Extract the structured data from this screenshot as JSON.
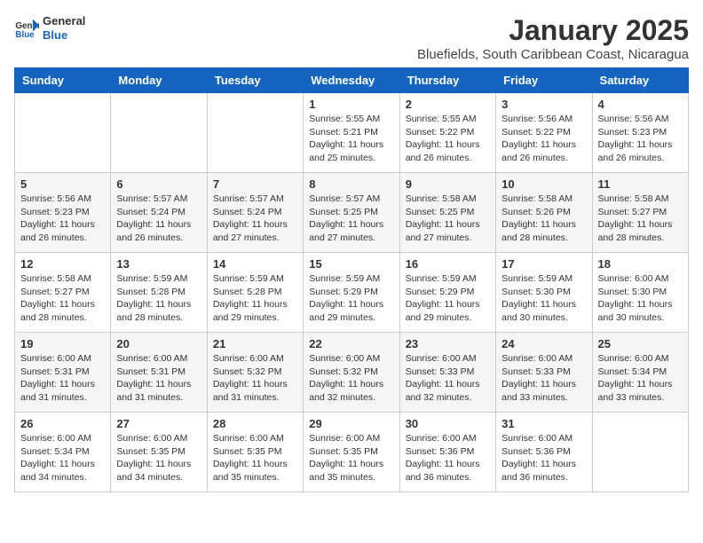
{
  "logo": {
    "general": "General",
    "blue": "Blue"
  },
  "title": "January 2025",
  "subtitle": "Bluefields, South Caribbean Coast, Nicaragua",
  "days_of_week": [
    "Sunday",
    "Monday",
    "Tuesday",
    "Wednesday",
    "Thursday",
    "Friday",
    "Saturday"
  ],
  "weeks": [
    [
      {
        "day": "",
        "info": ""
      },
      {
        "day": "",
        "info": ""
      },
      {
        "day": "",
        "info": ""
      },
      {
        "day": "1",
        "info": "Sunrise: 5:55 AM\nSunset: 5:21 PM\nDaylight: 11 hours and 25 minutes."
      },
      {
        "day": "2",
        "info": "Sunrise: 5:55 AM\nSunset: 5:22 PM\nDaylight: 11 hours and 26 minutes."
      },
      {
        "day": "3",
        "info": "Sunrise: 5:56 AM\nSunset: 5:22 PM\nDaylight: 11 hours and 26 minutes."
      },
      {
        "day": "4",
        "info": "Sunrise: 5:56 AM\nSunset: 5:23 PM\nDaylight: 11 hours and 26 minutes."
      }
    ],
    [
      {
        "day": "5",
        "info": "Sunrise: 5:56 AM\nSunset: 5:23 PM\nDaylight: 11 hours and 26 minutes."
      },
      {
        "day": "6",
        "info": "Sunrise: 5:57 AM\nSunset: 5:24 PM\nDaylight: 11 hours and 26 minutes."
      },
      {
        "day": "7",
        "info": "Sunrise: 5:57 AM\nSunset: 5:24 PM\nDaylight: 11 hours and 27 minutes."
      },
      {
        "day": "8",
        "info": "Sunrise: 5:57 AM\nSunset: 5:25 PM\nDaylight: 11 hours and 27 minutes."
      },
      {
        "day": "9",
        "info": "Sunrise: 5:58 AM\nSunset: 5:25 PM\nDaylight: 11 hours and 27 minutes."
      },
      {
        "day": "10",
        "info": "Sunrise: 5:58 AM\nSunset: 5:26 PM\nDaylight: 11 hours and 28 minutes."
      },
      {
        "day": "11",
        "info": "Sunrise: 5:58 AM\nSunset: 5:27 PM\nDaylight: 11 hours and 28 minutes."
      }
    ],
    [
      {
        "day": "12",
        "info": "Sunrise: 5:58 AM\nSunset: 5:27 PM\nDaylight: 11 hours and 28 minutes."
      },
      {
        "day": "13",
        "info": "Sunrise: 5:59 AM\nSunset: 5:28 PM\nDaylight: 11 hours and 28 minutes."
      },
      {
        "day": "14",
        "info": "Sunrise: 5:59 AM\nSunset: 5:28 PM\nDaylight: 11 hours and 29 minutes."
      },
      {
        "day": "15",
        "info": "Sunrise: 5:59 AM\nSunset: 5:29 PM\nDaylight: 11 hours and 29 minutes."
      },
      {
        "day": "16",
        "info": "Sunrise: 5:59 AM\nSunset: 5:29 PM\nDaylight: 11 hours and 29 minutes."
      },
      {
        "day": "17",
        "info": "Sunrise: 5:59 AM\nSunset: 5:30 PM\nDaylight: 11 hours and 30 minutes."
      },
      {
        "day": "18",
        "info": "Sunrise: 6:00 AM\nSunset: 5:30 PM\nDaylight: 11 hours and 30 minutes."
      }
    ],
    [
      {
        "day": "19",
        "info": "Sunrise: 6:00 AM\nSunset: 5:31 PM\nDaylight: 11 hours and 31 minutes."
      },
      {
        "day": "20",
        "info": "Sunrise: 6:00 AM\nSunset: 5:31 PM\nDaylight: 11 hours and 31 minutes."
      },
      {
        "day": "21",
        "info": "Sunrise: 6:00 AM\nSunset: 5:32 PM\nDaylight: 11 hours and 31 minutes."
      },
      {
        "day": "22",
        "info": "Sunrise: 6:00 AM\nSunset: 5:32 PM\nDaylight: 11 hours and 32 minutes."
      },
      {
        "day": "23",
        "info": "Sunrise: 6:00 AM\nSunset: 5:33 PM\nDaylight: 11 hours and 32 minutes."
      },
      {
        "day": "24",
        "info": "Sunrise: 6:00 AM\nSunset: 5:33 PM\nDaylight: 11 hours and 33 minutes."
      },
      {
        "day": "25",
        "info": "Sunrise: 6:00 AM\nSunset: 5:34 PM\nDaylight: 11 hours and 33 minutes."
      }
    ],
    [
      {
        "day": "26",
        "info": "Sunrise: 6:00 AM\nSunset: 5:34 PM\nDaylight: 11 hours and 34 minutes."
      },
      {
        "day": "27",
        "info": "Sunrise: 6:00 AM\nSunset: 5:35 PM\nDaylight: 11 hours and 34 minutes."
      },
      {
        "day": "28",
        "info": "Sunrise: 6:00 AM\nSunset: 5:35 PM\nDaylight: 11 hours and 35 minutes."
      },
      {
        "day": "29",
        "info": "Sunrise: 6:00 AM\nSunset: 5:35 PM\nDaylight: 11 hours and 35 minutes."
      },
      {
        "day": "30",
        "info": "Sunrise: 6:00 AM\nSunset: 5:36 PM\nDaylight: 11 hours and 36 minutes."
      },
      {
        "day": "31",
        "info": "Sunrise: 6:00 AM\nSunset: 5:36 PM\nDaylight: 11 hours and 36 minutes."
      },
      {
        "day": "",
        "info": ""
      }
    ]
  ]
}
